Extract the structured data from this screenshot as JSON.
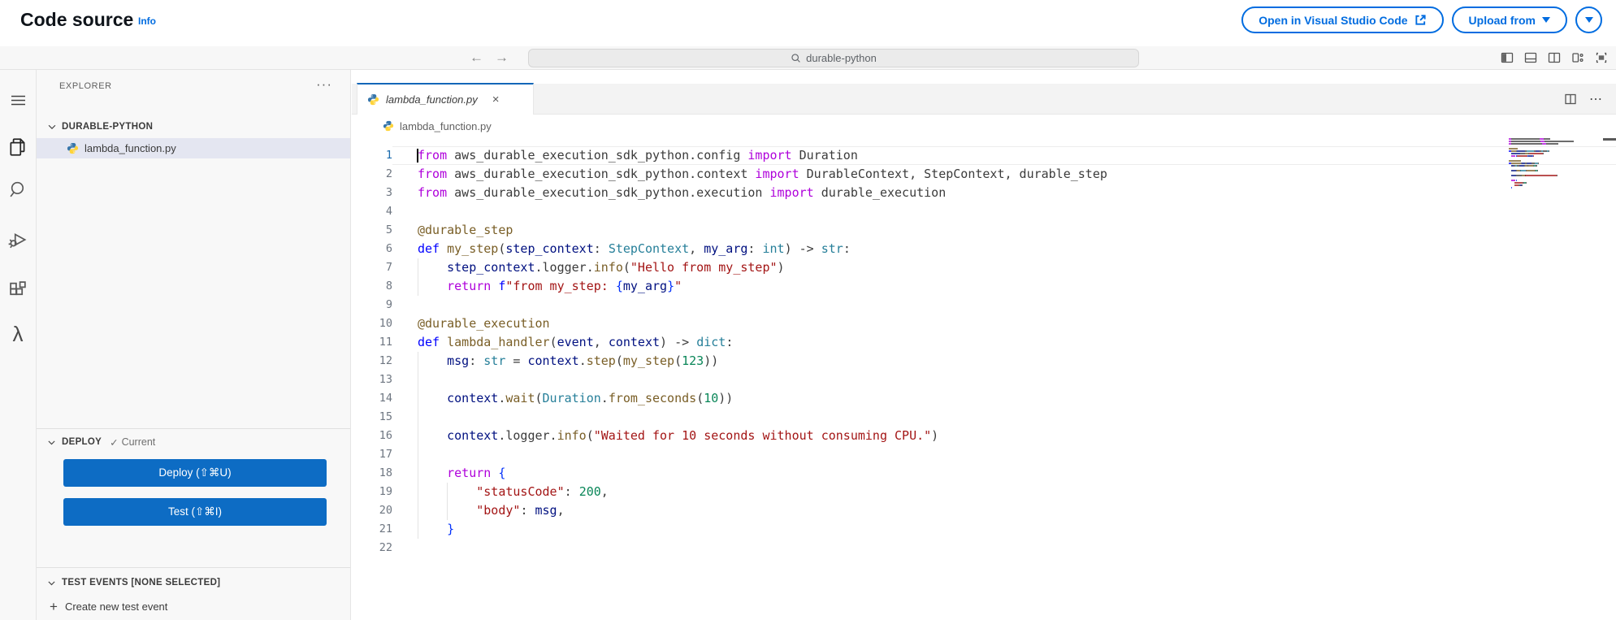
{
  "header": {
    "title": "Code source",
    "info_link": "Info",
    "open_vscode_button": "Open in Visual Studio Code",
    "upload_from_button": "Upload from"
  },
  "titlebar": {
    "search_value": "durable-python"
  },
  "explorer": {
    "title": "EXPLORER",
    "more": "···",
    "folder": "DURABLE-PYTHON",
    "file": "lambda_function.py"
  },
  "deploy": {
    "title": "DEPLOY",
    "status": "Current",
    "deploy_button": "Deploy (⇧⌘U)",
    "test_button": "Test (⇧⌘I)"
  },
  "test_events": {
    "title": "TEST EVENTS [NONE SELECTED]",
    "create": "Create new test event"
  },
  "editor": {
    "tab": "lambda_function.py",
    "tab_close": "×",
    "breadcrumb": "lambda_function.py",
    "more_actions": "⋯",
    "palette": {
      "kw": "#af00db",
      "df": "#0000ff",
      "fn": "#795e26",
      "ty": "#267f99",
      "vr": "#001080",
      "st": "#a31515",
      "nm": "#098658",
      "pl": "#3b3b3b",
      "br": "#0431fa"
    },
    "code": [
      {
        "g": [],
        "t": [
          [
            "kw",
            "from"
          ],
          [
            "pl",
            " aws_durable_execution_sdk_python.config "
          ],
          [
            "kw",
            "import"
          ],
          [
            "pl",
            " Duration"
          ]
        ]
      },
      {
        "g": [],
        "t": [
          [
            "kw",
            "from"
          ],
          [
            "pl",
            " aws_durable_execution_sdk_python.context "
          ],
          [
            "kw",
            "import"
          ],
          [
            "pl",
            " DurableContext, StepContext, durable_step"
          ]
        ]
      },
      {
        "g": [],
        "t": [
          [
            "kw",
            "from"
          ],
          [
            "pl",
            " aws_durable_execution_sdk_python.execution "
          ],
          [
            "kw",
            "import"
          ],
          [
            "pl",
            " durable_execution"
          ]
        ]
      },
      {
        "g": [],
        "t": []
      },
      {
        "g": [],
        "t": [
          [
            "fn",
            "@durable_step"
          ]
        ]
      },
      {
        "g": [],
        "t": [
          [
            "df",
            "def "
          ],
          [
            "fn",
            "my_step"
          ],
          [
            "pl",
            "("
          ],
          [
            "vr",
            "step_context"
          ],
          [
            "pl",
            ": "
          ],
          [
            "ty",
            "StepContext"
          ],
          [
            "pl",
            ", "
          ],
          [
            "vr",
            "my_arg"
          ],
          [
            "pl",
            ": "
          ],
          [
            "ty",
            "int"
          ],
          [
            "pl",
            ") -> "
          ],
          [
            "ty",
            "str"
          ],
          [
            "pl",
            ":"
          ]
        ]
      },
      {
        "g": [
          0
        ],
        "t": [
          [
            "pl",
            "    "
          ],
          [
            "vr",
            "step_context"
          ],
          [
            "pl",
            ".logger."
          ],
          [
            "fn",
            "info"
          ],
          [
            "pl",
            "("
          ],
          [
            "st",
            "\"Hello from my_step\""
          ],
          [
            "pl",
            ")"
          ]
        ]
      },
      {
        "g": [
          0
        ],
        "t": [
          [
            "pl",
            "    "
          ],
          [
            "kw",
            "return"
          ],
          [
            "pl",
            " "
          ],
          [
            "df",
            "f"
          ],
          [
            "st",
            "\"from my_step: "
          ],
          [
            "br",
            "{"
          ],
          [
            "vr",
            "my_arg"
          ],
          [
            "br",
            "}"
          ],
          [
            "st",
            "\""
          ]
        ]
      },
      {
        "g": [],
        "t": []
      },
      {
        "g": [],
        "t": [
          [
            "fn",
            "@durable_execution"
          ]
        ]
      },
      {
        "g": [],
        "t": [
          [
            "df",
            "def "
          ],
          [
            "fn",
            "lambda_handler"
          ],
          [
            "pl",
            "("
          ],
          [
            "vr",
            "event"
          ],
          [
            "pl",
            ", "
          ],
          [
            "vr",
            "context"
          ],
          [
            "pl",
            ") -> "
          ],
          [
            "ty",
            "dict"
          ],
          [
            "pl",
            ":"
          ]
        ]
      },
      {
        "g": [
          0
        ],
        "t": [
          [
            "pl",
            "    "
          ],
          [
            "vr",
            "msg"
          ],
          [
            "pl",
            ": "
          ],
          [
            "ty",
            "str"
          ],
          [
            "pl",
            " = "
          ],
          [
            "vr",
            "context"
          ],
          [
            "pl",
            "."
          ],
          [
            "fn",
            "step"
          ],
          [
            "pl",
            "("
          ],
          [
            "fn",
            "my_step"
          ],
          [
            "pl",
            "("
          ],
          [
            "nm",
            "123"
          ],
          [
            "pl",
            "))"
          ]
        ]
      },
      {
        "g": [
          0
        ],
        "t": []
      },
      {
        "g": [
          0
        ],
        "t": [
          [
            "pl",
            "    "
          ],
          [
            "vr",
            "context"
          ],
          [
            "pl",
            "."
          ],
          [
            "fn",
            "wait"
          ],
          [
            "pl",
            "("
          ],
          [
            "ty",
            "Duration"
          ],
          [
            "pl",
            "."
          ],
          [
            "fn",
            "from_seconds"
          ],
          [
            "pl",
            "("
          ],
          [
            "nm",
            "10"
          ],
          [
            "pl",
            "))"
          ]
        ]
      },
      {
        "g": [
          0
        ],
        "t": []
      },
      {
        "g": [
          0
        ],
        "t": [
          [
            "pl",
            "    "
          ],
          [
            "vr",
            "context"
          ],
          [
            "pl",
            ".logger."
          ],
          [
            "fn",
            "info"
          ],
          [
            "pl",
            "("
          ],
          [
            "st",
            "\"Waited for 10 seconds without consuming CPU.\""
          ],
          [
            "pl",
            ")"
          ]
        ]
      },
      {
        "g": [
          0
        ],
        "t": []
      },
      {
        "g": [
          0
        ],
        "t": [
          [
            "pl",
            "    "
          ],
          [
            "kw",
            "return"
          ],
          [
            "pl",
            " "
          ],
          [
            "br",
            "{"
          ]
        ]
      },
      {
        "g": [
          0,
          4
        ],
        "t": [
          [
            "pl",
            "        "
          ],
          [
            "st",
            "\"statusCode\""
          ],
          [
            "pl",
            ": "
          ],
          [
            "nm",
            "200"
          ],
          [
            "pl",
            ","
          ]
        ]
      },
      {
        "g": [
          0,
          4
        ],
        "t": [
          [
            "pl",
            "        "
          ],
          [
            "st",
            "\"body\""
          ],
          [
            "pl",
            ": "
          ],
          [
            "vr",
            "msg"
          ],
          [
            "pl",
            ","
          ]
        ]
      },
      {
        "g": [
          0
        ],
        "t": [
          [
            "pl",
            "    "
          ],
          [
            "br",
            "}"
          ]
        ]
      },
      {
        "g": [],
        "t": []
      }
    ]
  }
}
